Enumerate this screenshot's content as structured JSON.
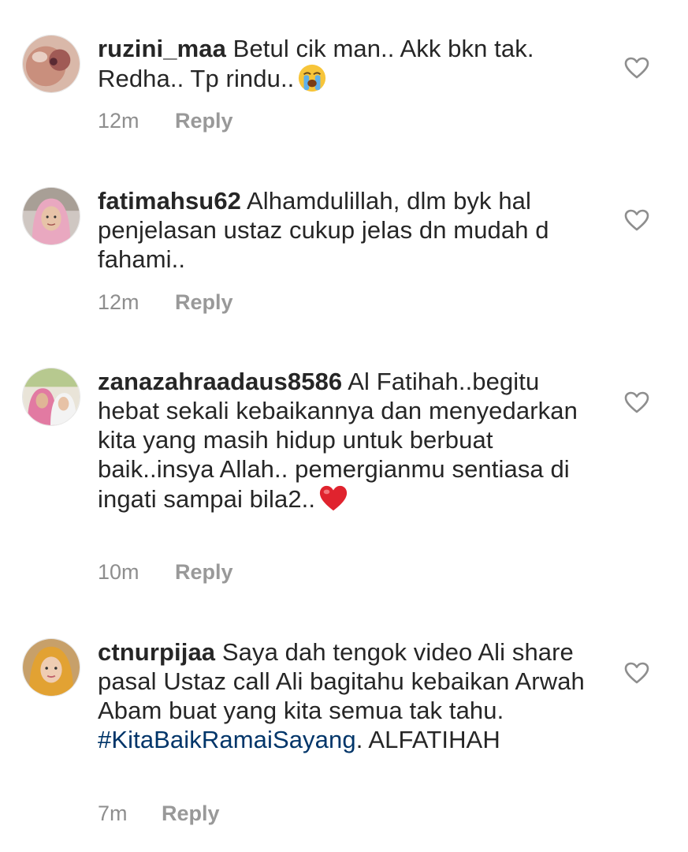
{
  "comments": [
    {
      "username": "ruzini_maa",
      "text": "Betul cik man.. Akk bkn tak. Redha.. Tp rindu..",
      "emoji": "loudly-crying-face-icon",
      "time": "12m",
      "reply_label": "Reply"
    },
    {
      "username": "fatimahsu62",
      "text": "Alhamdulillah, dlm byk hal penjelasan ustaz cukup jelas dn mudah d fahami..",
      "time": "12m",
      "reply_label": "Reply"
    },
    {
      "username": "zanazahraadaus8586",
      "text": "Al Fatihah..begitu hebat sekali kebaikannya dan menyedarkan kita yang masih hidup untuk berbuat baik..insya Allah.. pemergianmu sentiasa di ingati sampai bila2..",
      "emoji": "red-heart-icon",
      "time": "10m",
      "reply_label": "Reply"
    },
    {
      "username": "ctnurpijaa",
      "text_before": "Saya dah tengok video Ali share pasal Ustaz  call Ali bagitahu kebaikan Arwah Abam buat yang kita semua tak tahu.",
      "hashtag": "#KitaBaikRamaiSayang",
      "text_after": ". ALFATIHAH",
      "time": "7m",
      "reply_label": "Reply"
    }
  ],
  "icons": {
    "like": "heart-outline-icon"
  },
  "colors": {
    "text": "#262626",
    "meta": "#8e8e8e",
    "hashtag": "#003569",
    "heart_stroke": "#8e8e8e"
  }
}
